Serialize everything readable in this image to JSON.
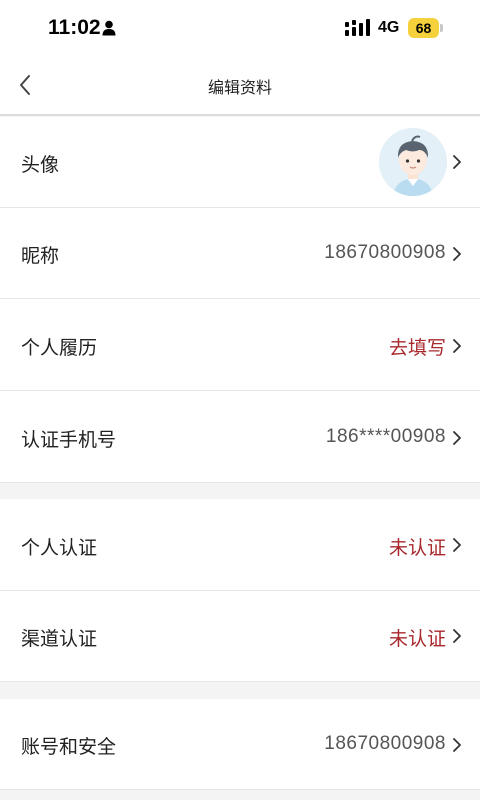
{
  "status_bar": {
    "time": "11:02",
    "network": "4G",
    "battery": "68"
  },
  "nav": {
    "title": "编辑资料"
  },
  "rows": [
    {
      "label": "头像",
      "value": ""
    },
    {
      "label": "昵称",
      "value": "18670800908"
    },
    {
      "label": "个人履历",
      "value": "去填写"
    },
    {
      "label": "认证手机号",
      "value": "186****00908"
    },
    {
      "label": "个人认证",
      "value": "未认证"
    },
    {
      "label": "渠道认证",
      "value": "未认证"
    },
    {
      "label": "账号和安全",
      "value": "18670800908"
    }
  ],
  "colors": {
    "accent_red": "#a8282c",
    "background": "#f4f4f4",
    "battery": "#f5d23c"
  },
  "icons": {
    "back": "chevron-left-icon",
    "row": "chevron-right-icon",
    "status": [
      "person-icon",
      "signal-icon"
    ]
  }
}
